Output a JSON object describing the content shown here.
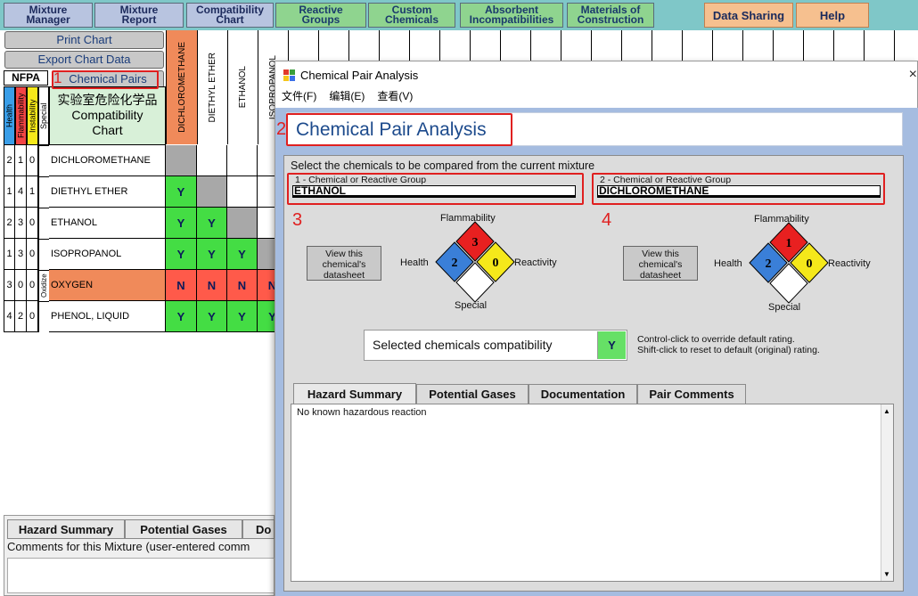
{
  "nav": {
    "mixture_manager": "Mixture\nManager",
    "mixture_report": "Mixture\nReport",
    "compatibility_chart": "Compatibility\nChart",
    "reactive_groups": "Reactive\nGroups",
    "custom_chemicals": "Custom\nChemicals",
    "absorbent": "Absorbent\nIncompatibilities",
    "materials": "Materials of\nConstruction",
    "data_sharing": "Data Sharing",
    "help": "Help"
  },
  "chart": {
    "print_chart": "Print Chart",
    "export_chart": "Export Chart Data",
    "chemical_pairs": "Chemical Pairs",
    "nfpa": "NFPA",
    "nfpa_cols": [
      "Health",
      "Flammability",
      "Instability",
      "Special"
    ],
    "title_cn": "实验室危险化学品",
    "title_en": "Compatibility\nChart",
    "columns": [
      "DICHLOROMETHANE",
      "DIETHYL ETHER",
      "ETHANOL",
      "ISOPROPANOL"
    ],
    "rows": [
      {
        "h": "2",
        "f": "1",
        "i": "0",
        "s": "",
        "name": "DICHLOROMETHANE",
        "cells": [
          "",
          "",
          "",
          ""
        ]
      },
      {
        "h": "1",
        "f": "4",
        "i": "1",
        "s": "",
        "name": "DIETHYL ETHER",
        "cells": [
          "Y",
          "",
          "",
          ""
        ]
      },
      {
        "h": "2",
        "f": "3",
        "i": "0",
        "s": "",
        "name": "ETHANOL",
        "cells": [
          "Y",
          "Y",
          "",
          ""
        ]
      },
      {
        "h": "1",
        "f": "3",
        "i": "0",
        "s": "",
        "name": "ISOPROPANOL",
        "cells": [
          "Y",
          "Y",
          "Y",
          ""
        ]
      },
      {
        "h": "3",
        "f": "0",
        "i": "0",
        "s": "Oxidize",
        "name": "OXYGEN",
        "cells": [
          "N",
          "N",
          "N",
          "N"
        ]
      },
      {
        "h": "4",
        "f": "2",
        "i": "0",
        "s": "",
        "name": "PHENOL, LIQUID",
        "cells": [
          "Y",
          "Y",
          "Y",
          "Y"
        ]
      }
    ]
  },
  "bottom": {
    "tabs": [
      "Hazard Summary",
      "Potential Gases",
      "Do"
    ],
    "comments_label": "Comments for this Mixture (user-entered comm"
  },
  "dialog": {
    "title": "Chemical Pair Analysis",
    "close": "×",
    "menu": [
      "文件(F)",
      "编辑(E)",
      "查看(V)"
    ],
    "heading": "Chemical Pair Analysis",
    "instruction": "Select the chemicals to be compared from the current mixture",
    "chem1_label": "1 - Chemical or Reactive Group",
    "chem1_value": "ETHANOL",
    "chem2_label": "2 - Chemical or Reactive Group",
    "chem2_value": "DICHLOROMETHANE",
    "datasheet_btn": "View this\nchemical's\ndatasheet",
    "diamond1": {
      "flammability": "3",
      "health": "2",
      "reactivity": "0",
      "special": ""
    },
    "diamond2": {
      "flammability": "1",
      "health": "2",
      "reactivity": "0",
      "special": ""
    },
    "labels": {
      "flammability": "Flammability",
      "health": "Health",
      "reactivity": "Reactivity",
      "special": "Special"
    },
    "compat_label": "Selected chemicals compatibility",
    "compat_value": "Y",
    "hint1": "Control-click to override default rating.",
    "hint2": "Shift-click to reset to default (original) rating.",
    "tabs": [
      "Hazard Summary",
      "Potential Gases",
      "Documentation",
      "Pair Comments"
    ],
    "content": "No known hazardous reaction"
  },
  "annotations": [
    "1",
    "2",
    "3",
    "4"
  ],
  "colors": {
    "compatible": "#44dd44",
    "incompatible": "#ff5a4a",
    "nfpa_health": "#3a7fd8",
    "nfpa_flammability": "#e82020",
    "nfpa_reactivity": "#f5e81a"
  }
}
